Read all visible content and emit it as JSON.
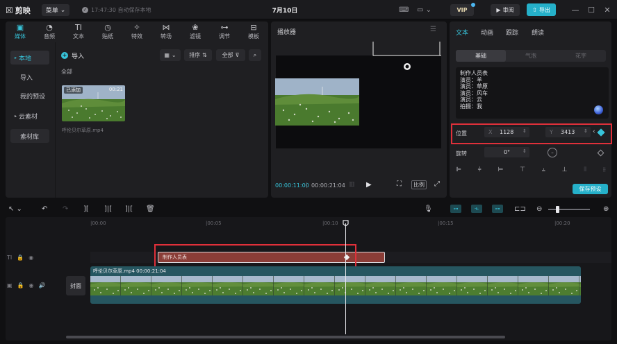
{
  "app": {
    "name": "剪映",
    "menu_label": "菜单",
    "save_status": "17:47:30 自动保存本地",
    "doc_title": "7月10日",
    "vip_label": "VIP",
    "review_label": "审阅",
    "export_label": "导出"
  },
  "media_panel": {
    "tabs": [
      {
        "label": "媒体",
        "icon": "media-icon",
        "active": true
      },
      {
        "label": "音频",
        "icon": "audio-icon"
      },
      {
        "label": "文本",
        "icon": "text-icon"
      },
      {
        "label": "贴纸",
        "icon": "sticker-icon"
      },
      {
        "label": "特效",
        "icon": "effects-icon"
      },
      {
        "label": "转场",
        "icon": "transition-icon"
      },
      {
        "label": "滤镜",
        "icon": "filter-icon"
      },
      {
        "label": "调节",
        "icon": "adjust-icon"
      },
      {
        "label": "模板",
        "icon": "template-icon"
      }
    ],
    "side_nav": [
      {
        "label": "本地",
        "active": true,
        "arrow": true
      },
      {
        "label": "导入"
      },
      {
        "label": "我的预设"
      },
      {
        "label": "云素材",
        "arrow": true
      },
      {
        "label": "素材库",
        "boxed": true
      }
    ],
    "import_label": "导入",
    "sort_label": "排序",
    "all_filter_label": "全部",
    "all_label": "全部",
    "item": {
      "badge": "已添加",
      "duration": "00:21",
      "name": "呼伦贝尔草原.mp4"
    }
  },
  "player": {
    "title": "播放器",
    "current_time": "00:00:11:00",
    "total_time": "00:00:21:04",
    "ratio_label": "比例"
  },
  "properties": {
    "tabs": [
      {
        "label": "文本",
        "active": true
      },
      {
        "label": "动画"
      },
      {
        "label": "跟踪"
      },
      {
        "label": "朗读"
      }
    ],
    "sub_tabs": [
      {
        "label": "基础",
        "active": true
      },
      {
        "label": "气泡"
      },
      {
        "label": "花字"
      }
    ],
    "text_lines": [
      "制作人员表",
      "演员：羊",
      "演员：草原",
      "演员：风车",
      "演员：云",
      "拍摄：我"
    ],
    "position_label": "位置",
    "pos_x_axis": "X",
    "pos_x": "1128",
    "pos_y_axis": "Y",
    "pos_y": "3413",
    "rotation_label": "旋转",
    "rotation_value": "0°",
    "save_preset_label": "保存预设"
  },
  "timeline": {
    "ruler_labels": [
      "00:00",
      "00:05",
      "00:10",
      "00:15",
      "00:20"
    ],
    "text_clip_label": "制作人员表",
    "video_clip_label": "呼伦贝尔草原.mp4   00:00:21:04",
    "cover_label": "封面",
    "text_track_type": "TI",
    "accent_color": "#37c4da",
    "highlight_color": "#e0303a"
  }
}
